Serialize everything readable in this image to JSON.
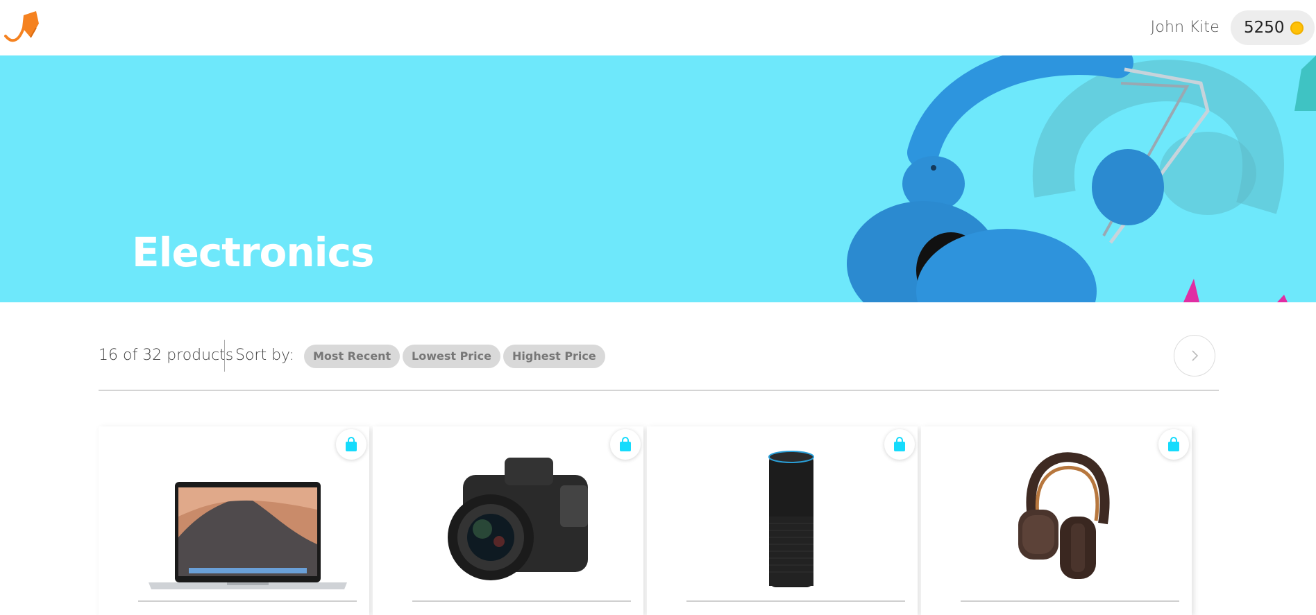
{
  "header": {
    "user_name": "John Kite",
    "coins": "5250",
    "accent_color": "#f58220",
    "coin_color": "#ffc107"
  },
  "hero": {
    "title": "Electronics",
    "background_color": "#6ee8fb"
  },
  "toolbar": {
    "product_count": "16 of 32 products",
    "sort_label": "Sort by:",
    "sort_options": [
      "Most Recent",
      "Lowest Price",
      "Highest Price"
    ],
    "next_icon": "chevron-right-icon"
  },
  "products": [
    {
      "image": "laptop-image",
      "action_icon": "shopping-bag-icon"
    },
    {
      "image": "camera-image",
      "action_icon": "shopping-bag-icon"
    },
    {
      "image": "smart-speaker-image",
      "action_icon": "shopping-bag-icon"
    },
    {
      "image": "headphones-image",
      "action_icon": "shopping-bag-icon"
    }
  ],
  "colors": {
    "bag_icon": "#15dbfc",
    "sort_button_bg": "#d9d9d9"
  }
}
